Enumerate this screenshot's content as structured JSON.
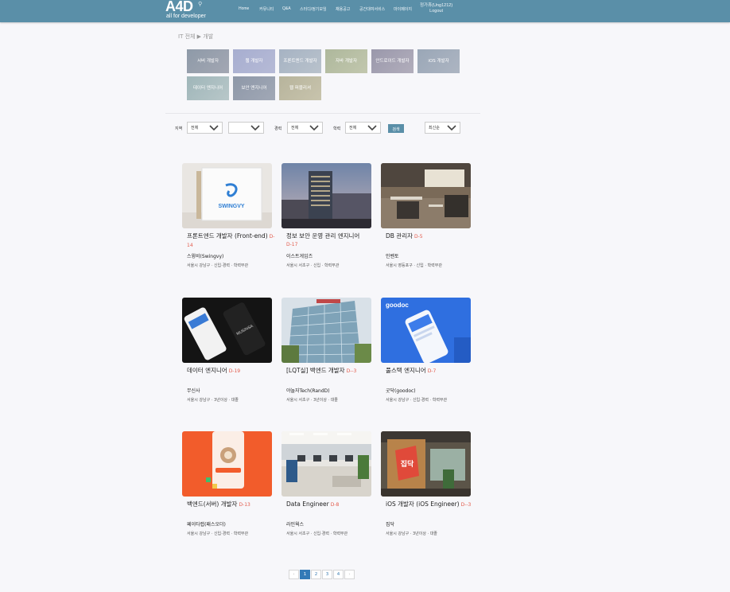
{
  "header": {
    "logo_main": "A4D",
    "logo_sub": "all for developer",
    "nav": [
      "Home",
      "커뮤니티",
      "Q&A",
      "스터디/정기모임",
      "채용공고",
      "공간대여서비스",
      "마이페이지"
    ],
    "user_label": "정가휴(Ung1212)",
    "logout_label": "Logout"
  },
  "breadcrumb": "IT 전체 ▶ 개발",
  "categories": [
    "서버 개발자",
    "웹 개발자",
    "프론트엔드 개발자",
    "자바 개발자",
    "안드로이드 개발자",
    "iOS 개발자",
    "데이터 엔지니어",
    "보안 엔지니어",
    "웹 퍼블리셔"
  ],
  "filters": {
    "region_label": "지역",
    "region_value": "전체",
    "region_sub_value": "",
    "career_label": "경력",
    "career_value": "전체",
    "edu_label": "학력",
    "edu_value": "전체",
    "search_label": "검색",
    "sort_value": "최신순"
  },
  "jobs": [
    {
      "title": "프론트엔드 개발자 (Front-end)",
      "dday": "D-14",
      "company": "스윙비(Swingvy)",
      "meta": "서울시 강남구 · 신입·경력 · 학력무관",
      "thumb_text": "SWINGVY",
      "thumb_text2": ""
    },
    {
      "title": "정보 보안 운영 관리 엔지니어",
      "dday": "D-17",
      "company": "이스트게임즈",
      "meta": "서울시 서초구 · 신입 · 학력무관",
      "thumb_text": "",
      "thumb_text2": ""
    },
    {
      "title": "DB 관리자",
      "dday": "D-5",
      "company": "인벤토",
      "meta": "서울시 영등포구 · 신입 · 학력무관",
      "thumb_text": "",
      "thumb_text2": ""
    },
    {
      "title": "데이터 엔지니어",
      "dday": "D-19",
      "company": "무신사",
      "meta": "서울시 강남구 · 3년이상 · 대졸",
      "thumb_text": "MUSINSA",
      "thumb_text2": ""
    },
    {
      "title": "[LQT실] 백엔드 개발자",
      "dday": "D--3",
      "company": "야놀자Tech(RandD)",
      "meta": "서울시 서초구 · 3년이상 · 대졸",
      "thumb_text": "",
      "thumb_text2": ""
    },
    {
      "title": "풀스택 엔지니어",
      "dday": "D-7",
      "company": "굿닥(goodoc)",
      "meta": "서울시 강남구 · 신입·경력 · 학력무관",
      "thumb_text": "goodoc",
      "thumb_text2": "goodoc"
    },
    {
      "title": "백엔드(서버) 개발자",
      "dday": "D-13",
      "company": "페이타랩(패스오더)",
      "meta": "서울시 강남구 · 신입·경력 · 학력무관",
      "thumb_text": "",
      "thumb_text2": ""
    },
    {
      "title": "Data Engineer",
      "dday": "D-8",
      "company": "라인웍스",
      "meta": "서울시 서초구 · 신입·경력 · 학력무관",
      "thumb_text": "",
      "thumb_text2": ""
    },
    {
      "title": "iOS 개발자 (iOS Engineer)",
      "dday": "D--3",
      "company": "집닥",
      "meta": "서울시 강남구 · 3년이상 · 대졸",
      "thumb_text": "집닥",
      "thumb_text2": ""
    }
  ],
  "pagination": {
    "prev": "‹",
    "pages": [
      "1",
      "2",
      "3",
      "4"
    ],
    "next": "›",
    "active": "1"
  },
  "colors": {
    "header": "#5a8fa8",
    "dday": "#e35a4a",
    "active_page": "#337ab7"
  }
}
